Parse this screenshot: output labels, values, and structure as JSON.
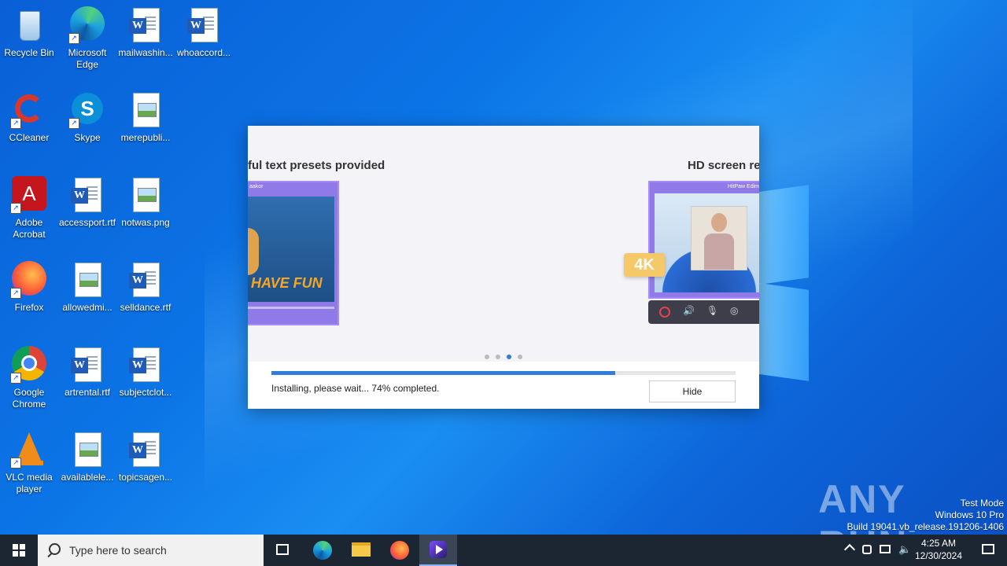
{
  "desktop": {
    "icons": [
      {
        "label": "Recycle Bin",
        "icon": "recycle-bin-icon"
      },
      {
        "label": "Microsoft Edge",
        "icon": "edge-icon"
      },
      {
        "label": "mailwashin...",
        "icon": "word-doc-icon"
      },
      {
        "label": "whoaccord...",
        "icon": "word-doc-icon"
      },
      {
        "label": "CCleaner",
        "icon": "ccleaner-icon"
      },
      {
        "label": "Skype",
        "icon": "skype-icon"
      },
      {
        "label": "merepubli...",
        "icon": "image-file-icon"
      },
      {
        "label": "Adobe Acrobat",
        "icon": "acrobat-icon"
      },
      {
        "label": "accessport.rtf",
        "icon": "word-doc-icon"
      },
      {
        "label": "notwas.png",
        "icon": "image-file-icon"
      },
      {
        "label": "Firefox",
        "icon": "firefox-icon"
      },
      {
        "label": "allowedmi...",
        "icon": "image-file-icon"
      },
      {
        "label": "selldance.rtf",
        "icon": "word-doc-icon"
      },
      {
        "label": "Google Chrome",
        "icon": "chrome-icon"
      },
      {
        "label": "artrental.rtf",
        "icon": "word-doc-icon"
      },
      {
        "label": "subjectclot...",
        "icon": "word-doc-icon"
      },
      {
        "label": "VLC media player",
        "icon": "vlc-icon"
      },
      {
        "label": "availablele...",
        "icon": "image-file-icon"
      },
      {
        "label": "topicsagen...",
        "icon": "word-doc-icon"
      }
    ]
  },
  "installer": {
    "slide_left_title": "ful text presets provided",
    "slide_right_title": "HD screen re",
    "left_panel_caption": "aakor",
    "left_panel_text": "Have Fun",
    "right_panel_caption": "HitPaw Edim",
    "badge_4k": "4K",
    "carousel_active_index": 2,
    "carousel_count": 4,
    "progress_percent": 74,
    "status_text": "Installing, please wait... 74% completed.",
    "hide_label": "Hide",
    "accent_color": "#2f7ed8"
  },
  "watermark": {
    "line1": "Test Mode",
    "line2": "Windows 10 Pro",
    "line3": "Build 19041.vb_release.191206-1406",
    "brand": "ANY RUN"
  },
  "taskbar": {
    "search_placeholder": "Type here to search",
    "pinned": [
      "task-view-icon",
      "edge-icon",
      "file-explorer-icon",
      "firefox-icon",
      "hitpaw-icon"
    ],
    "time": "4:25 AM",
    "date": "12/30/2024"
  }
}
